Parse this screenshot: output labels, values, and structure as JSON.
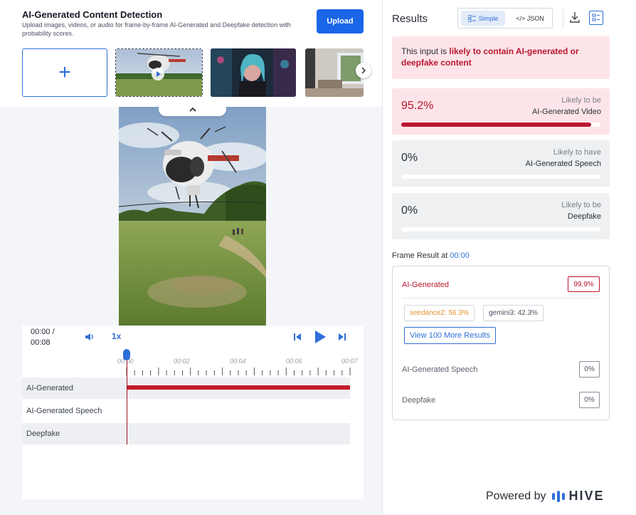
{
  "header": {
    "title": "AI-Generated Content Detection",
    "subtitle": "Upload images, videos, or audio for frame-by-frame AI-Generated and Deepfake detection with probability scores.",
    "upload_label": "Upload"
  },
  "thumbnails": {
    "add_symbol": "+",
    "items": [
      {
        "name": "helicopter-video",
        "selected": true,
        "has_play": true
      },
      {
        "name": "neon-portrait",
        "selected": false
      },
      {
        "name": "interior-room",
        "selected": false
      }
    ]
  },
  "player": {
    "time_current": "00:00 /",
    "time_total": "00:08",
    "speed": "1x"
  },
  "timeline": {
    "ticks": [
      "00:00",
      "00:02",
      "00:04",
      "00:06",
      "00:07"
    ],
    "tracks": [
      "AI-Generated",
      "AI-Generated Speech",
      "Deepfake"
    ],
    "ai_generated_fraction": 1.0
  },
  "results": {
    "title": "Results",
    "toggle_simple": "Simple",
    "toggle_json": "</> JSON",
    "alert_prefix": "This input is ",
    "alert_strong": "likely to contain AI-generated or deepfake content",
    "cards": [
      {
        "score": "95.2%",
        "likely": "Likely to be",
        "target": "AI-Generated Video",
        "fraction": 0.952
      },
      {
        "score": "0%",
        "likely": "Likely to have",
        "target": "AI-Generated Speech",
        "fraction": 0
      },
      {
        "score": "0%",
        "likely": "Likely to be",
        "target": "Deepfake",
        "fraction": 0
      }
    ]
  },
  "frame_result": {
    "title_prefix": "Frame Result at ",
    "timestamp": "00:00",
    "ai_label": "AI-Generated",
    "ai_score": "99.9%",
    "chips": [
      "seedance2: 56.3%",
      "gemini3: 42.3%"
    ],
    "view_more": "View 100 More Results",
    "speech_label": "AI-Generated Speech",
    "speech_score": "0%",
    "deepfake_label": "Deepfake",
    "deepfake_score": "0%"
  },
  "footer": {
    "powered_by": "Powered by",
    "brand": "HIVE"
  },
  "colors": {
    "accent": "#1a66e8",
    "alert_red": "#b81730",
    "alert_bg": "#fde4e8",
    "chip_orange": "#e0902b"
  }
}
